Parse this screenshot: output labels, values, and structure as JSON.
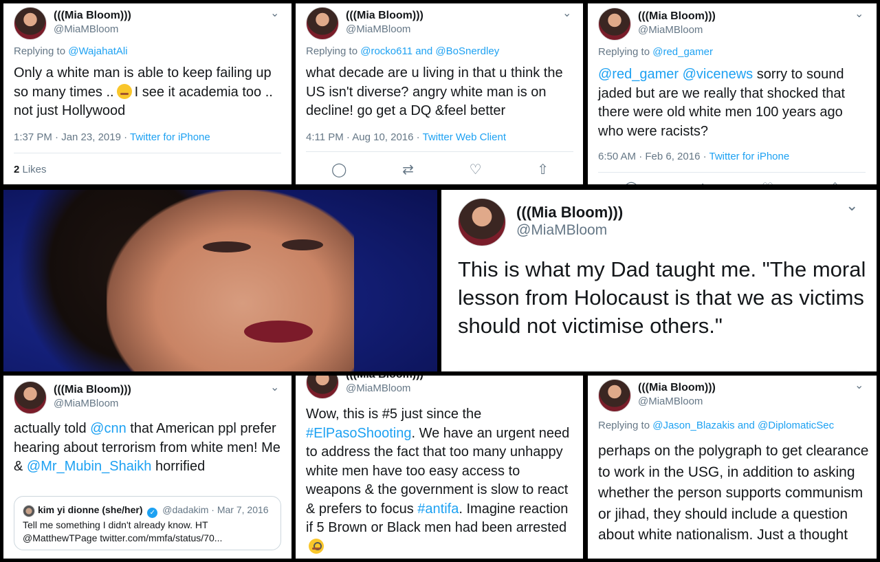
{
  "profile": {
    "name": "(((Mia Bloom)))",
    "handle": "@MiaMBloom"
  },
  "tweets": [
    {
      "reply_prefix": "Replying to ",
      "reply_to": "@WajahatAli",
      "text_a": "Only a white man is able to keep failing up so many times ..",
      "text_b": "I see it academia too .. not just Hollywood",
      "time": "1:37 PM · Jan 23, 2019 · ",
      "client": "Twitter for iPhone",
      "likes_count": "2",
      "likes_label": " Likes"
    },
    {
      "reply_prefix": "Replying to ",
      "reply_to_1": "@rocko611",
      "reply_and": " and ",
      "reply_to_2": "@BoSnerdley",
      "text": "what decade are u living in that u think the US isn't diverse? angry white man is on decline! go get a DQ &feel better",
      "time": "4:11 PM · Aug 10, 2016 · ",
      "client": "Twitter Web Client"
    },
    {
      "reply_prefix": "Replying to ",
      "reply_to": "@red_gamer",
      "mention_1": "@red_gamer",
      "mention_2": "@vicenews",
      "text": " sorry to sound jaded but are we really that shocked that there were old white men 100 years ago who were racists?",
      "time": "6:50 AM · Feb 6, 2016 · ",
      "client": "Twitter for iPhone"
    },
    {
      "text": "This is what my Dad taught me. \"The moral lesson from Holocaust is that we as victims should not victimise others.\""
    },
    {
      "text_a": "actually told ",
      "mention_1": "@cnn",
      "text_b": " that American ppl prefer hearing about terrorism from white men! Me & ",
      "mention_2": "@Mr_Mubin_Shaikh",
      "text_c": " horrified",
      "quote": {
        "name": "kim yi dionne (she/her)",
        "handle_date": "@dadakim · Mar 7, 2016",
        "text": "Tell me something I didn't already know. HT @MatthewTPage twitter.com/mmfa/status/70..."
      }
    },
    {
      "text_a": "Wow, this is #5 just since the ",
      "hashtag_1": "#ElPasoShooting",
      "text_b": ". We have an urgent need to address the fact that too many unhappy white men have too easy access to weapons & the government is slow to react & prefers to focus ",
      "hashtag_2": "#antifa",
      "text_c": ". Imagine reaction if 5 Brown or Black men had been arrested"
    },
    {
      "reply_prefix": "Replying to ",
      "reply_to_1": "@Jason_Blazakis",
      "reply_and": " and ",
      "reply_to_2": "@DiplomaticSec",
      "text": "perhaps on the polygraph to get clearance to work in the USG,  in addition to asking whether the person supports communism or jihad, they should include a question about white nationalism. Just a thought"
    }
  ],
  "icons": {
    "chevron": "⌄",
    "reply": "◯",
    "retweet": "⇄",
    "like": "♡",
    "share": "⇧",
    "verified": "✓"
  },
  "colors": {
    "link": "#1da1f2",
    "secondary": "#657786",
    "text": "#14171a",
    "collage_border": "#000000"
  }
}
